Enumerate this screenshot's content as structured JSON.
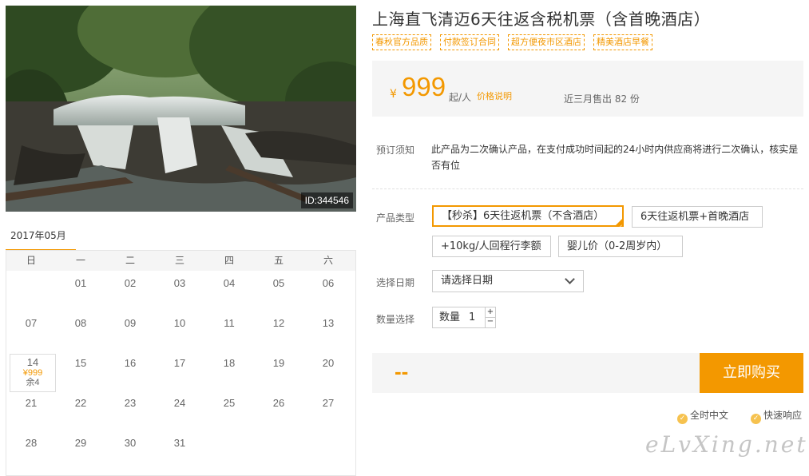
{
  "photo": {
    "id_label": "ID:344546",
    "alt": "waterfall-photo"
  },
  "calendar": {
    "tab": "2017年05月",
    "weekdays": [
      "日",
      "一",
      "二",
      "三",
      "四",
      "五",
      "六"
    ],
    "days": [
      [
        "",
        "01",
        "02",
        "03",
        "04",
        "05",
        "06"
      ],
      [
        "07",
        "08",
        "09",
        "10",
        "11",
        "12",
        "13"
      ],
      [
        "14",
        "15",
        "16",
        "17",
        "18",
        "19",
        "20"
      ],
      [
        "21",
        "22",
        "23",
        "24",
        "25",
        "26",
        "27"
      ],
      [
        "28",
        "29",
        "30",
        "31",
        "",
        "",
        ""
      ]
    ],
    "active_day": {
      "day": "14",
      "price": "¥999",
      "remain": "余4"
    }
  },
  "product": {
    "title": "上海直飞清迈6天往返含税机票（含首晚酒店）",
    "tags": [
      "春秋官方品质",
      "付款签订合同",
      "超方便夜市区酒店",
      "精美酒店早餐"
    ],
    "price": {
      "currency": "¥",
      "amount": "999",
      "unit": "起/人",
      "explain": "价格说明",
      "sold": "近三月售出 82 份"
    },
    "notice": {
      "label": "预订须知",
      "text": "此产品为二次确认产品，在支付成功时间起的24小时内供应商将进行二次确认，核实是否有位"
    },
    "types": {
      "label": "产品类型",
      "options": [
        "【秒杀】6天往返机票（不含酒店）",
        "6天往返机票+首晚酒店",
        "+10kg/人回程行李额",
        "婴儿价（0-2周岁内）"
      ],
      "selected": 0
    },
    "date": {
      "label": "选择日期",
      "placeholder": "请选择日期"
    },
    "quantity": {
      "label": "数量选择",
      "prefix": "数量",
      "value": "1",
      "plus": "+",
      "minus": "−"
    },
    "total": "--",
    "buy_label": "立即购买",
    "promises": [
      "全时中文",
      "快速响应"
    ],
    "watermark": "eLvXing.net"
  },
  "colors": {
    "accent": "#f39800",
    "bg_gray": "#f5f5f5"
  }
}
